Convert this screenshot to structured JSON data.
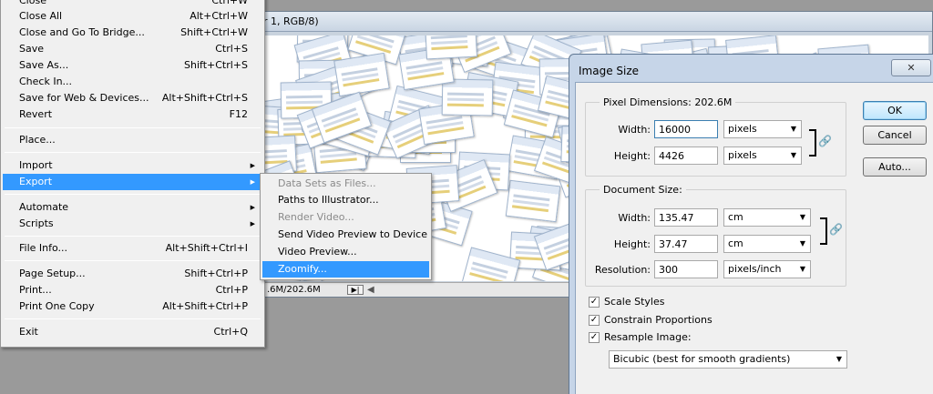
{
  "document": {
    "title_fragment": "r 1, RGB/8)",
    "status_size": ".6M/202.6M",
    "status_arrow": "▶|",
    "scroll_left": "◀"
  },
  "file_menu": {
    "items": [
      {
        "label": "Close",
        "shortcut": "Ctrl+W"
      },
      {
        "label": "Close All",
        "shortcut": "Alt+Ctrl+W"
      },
      {
        "label": "Close and Go To Bridge...",
        "shortcut": "Shift+Ctrl+W"
      },
      {
        "label": "Save",
        "shortcut": "Ctrl+S"
      },
      {
        "label": "Save As...",
        "shortcut": "Shift+Ctrl+S"
      },
      {
        "label": "Check In...",
        "shortcut": ""
      },
      {
        "label": "Save for Web & Devices...",
        "shortcut": "Alt+Shift+Ctrl+S"
      },
      {
        "label": "Revert",
        "shortcut": "F12"
      },
      {
        "label": "Place...",
        "shortcut": ""
      },
      {
        "label": "Import",
        "shortcut": ""
      },
      {
        "label": "Export",
        "shortcut": ""
      },
      {
        "label": "Automate",
        "shortcut": ""
      },
      {
        "label": "Scripts",
        "shortcut": ""
      },
      {
        "label": "File Info...",
        "shortcut": "Alt+Shift+Ctrl+I"
      },
      {
        "label": "Page Setup...",
        "shortcut": "Shift+Ctrl+P"
      },
      {
        "label": "Print...",
        "shortcut": "Ctrl+P"
      },
      {
        "label": "Print One Copy",
        "shortcut": "Alt+Shift+Ctrl+P"
      },
      {
        "label": "Exit",
        "shortcut": "Ctrl+Q"
      }
    ],
    "submenu_arrow": "▶"
  },
  "export_submenu": {
    "items": [
      {
        "label": "Data Sets as Files...",
        "enabled": false
      },
      {
        "label": "Paths to Illustrator...",
        "enabled": true
      },
      {
        "label": "Render Video...",
        "enabled": false
      },
      {
        "label": "Send Video Preview to Device",
        "enabled": true
      },
      {
        "label": "Video Preview...",
        "enabled": true
      },
      {
        "label": "Zoomify...",
        "enabled": true
      }
    ]
  },
  "image_size_dialog": {
    "title": "Image Size",
    "close_glyph": "✕",
    "pixel_dimensions": {
      "legend": "Pixel Dimensions:  202.6M",
      "width_label": "Width:",
      "width_value": "16000",
      "width_unit": "pixels",
      "height_label": "Height:",
      "height_value": "4426",
      "height_unit": "pixels"
    },
    "document_size": {
      "legend": "Document Size:",
      "width_label": "Width:",
      "width_value": "135.47",
      "width_unit": "cm",
      "height_label": "Height:",
      "height_value": "37.47",
      "height_unit": "cm",
      "resolution_label": "Resolution:",
      "resolution_value": "300",
      "resolution_unit": "pixels/inch"
    },
    "buttons": {
      "ok": "OK",
      "cancel": "Cancel",
      "auto": "Auto..."
    },
    "checkboxes": {
      "scale_styles": {
        "label": "Scale Styles",
        "checked": true
      },
      "constrain_proportions": {
        "label": "Constrain Proportions",
        "checked": true
      },
      "resample_image": {
        "label": "Resample Image:",
        "checked": true
      }
    },
    "resample_method": "Bicubic (best for smooth gradients)",
    "check_glyph": "✓",
    "caret_glyph": "▼",
    "chain_glyph": "🔗"
  },
  "colors": {
    "menu_highlight": "#3399ff",
    "dialog_frame": "#c6d5e8",
    "menu_bg": "#f0f0f0"
  }
}
